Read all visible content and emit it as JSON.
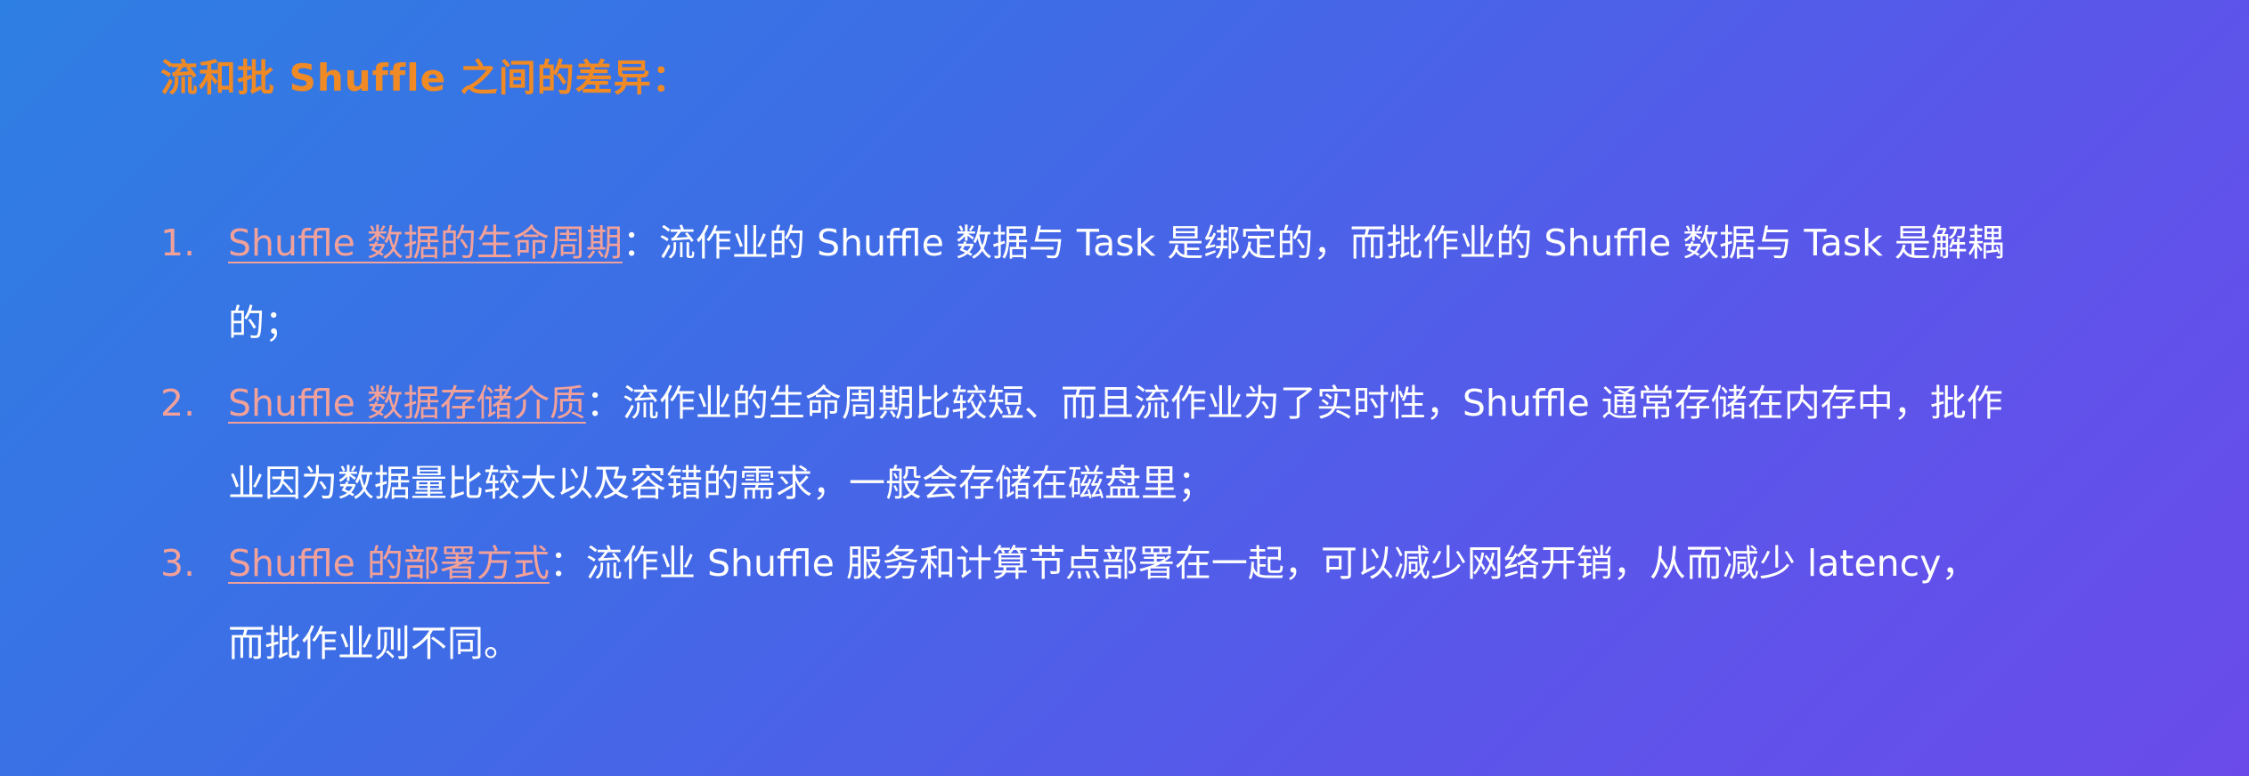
{
  "slide": {
    "title": "流和批 Shuffle 之间的差异：",
    "items": [
      {
        "number": "1.",
        "topic": "Shuffle 数据的生命周期",
        "text": "：流作业的 Shuffle 数据与 Task 是绑定的，而批作业的 Shuffle 数据与 Task 是解耦的；"
      },
      {
        "number": "2.",
        "topic": "Shuffle 数据存储介质",
        "text": "：流作业的生命周期比较短、而且流作业为了实时性，Shuffle 通常存储在内存中，批作业因为数据量比较大以及容错的需求，一般会存储在磁盘里；"
      },
      {
        "number": "3.",
        "topic": "Shuffle 的部署方式",
        "text": "：流作业 Shuffle 服务和计算节点部署在一起，可以减少网络开销，从而减少 latency，而批作业则不同。"
      }
    ]
  },
  "colors": {
    "title": "#f08a24",
    "topic_link": "#f2a19a",
    "body_text": "#ffffff",
    "background_start": "#2e7fe3",
    "background_end": "#6a4bea"
  }
}
